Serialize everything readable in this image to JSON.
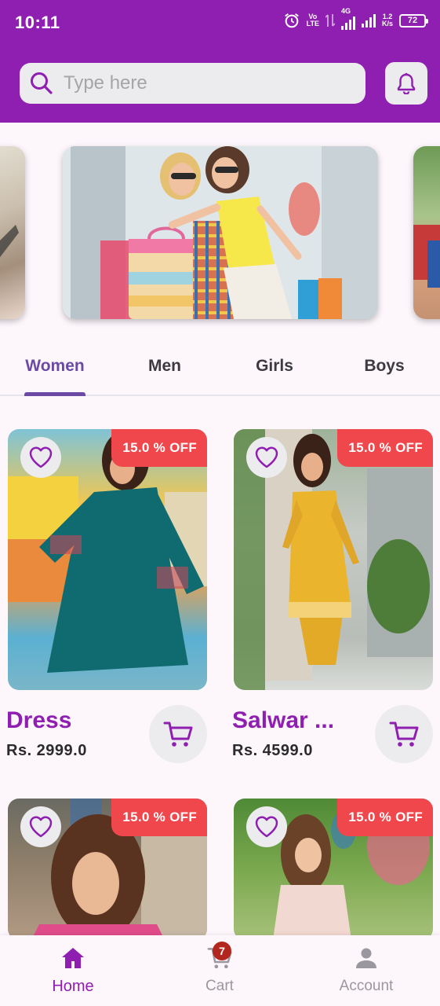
{
  "status_bar": {
    "time": "10:11",
    "network_label_top": "Vo",
    "network_label_bottom": "LTE",
    "network_type": "4G",
    "speed_value": "1.2",
    "speed_unit": "K/s",
    "battery_level": "72"
  },
  "search": {
    "placeholder": "Type here"
  },
  "colors": {
    "brand": "#8f1fb0",
    "tab_accent": "#6a4aa5",
    "discount_badge": "#f0474c"
  },
  "tabs": [
    {
      "label": "Women",
      "active": true
    },
    {
      "label": "Men",
      "active": false
    },
    {
      "label": "Girls",
      "active": false
    },
    {
      "label": "Boys",
      "active": false
    }
  ],
  "products": [
    {
      "name": "Dress",
      "price": "Rs. 2999.0",
      "discount": "15.0 % OFF"
    },
    {
      "name": "Salwar ...",
      "price": "Rs. 4599.0",
      "discount": "15.0 % OFF"
    },
    {
      "discount": "15.0 % OFF"
    },
    {
      "discount": "15.0 % OFF"
    }
  ],
  "bottom_nav": [
    {
      "label": "Home",
      "icon": "home-icon",
      "active": true
    },
    {
      "label": "Cart",
      "icon": "cart-icon",
      "active": false,
      "badge": "7"
    },
    {
      "label": "Account",
      "icon": "account-icon",
      "active": false
    }
  ]
}
